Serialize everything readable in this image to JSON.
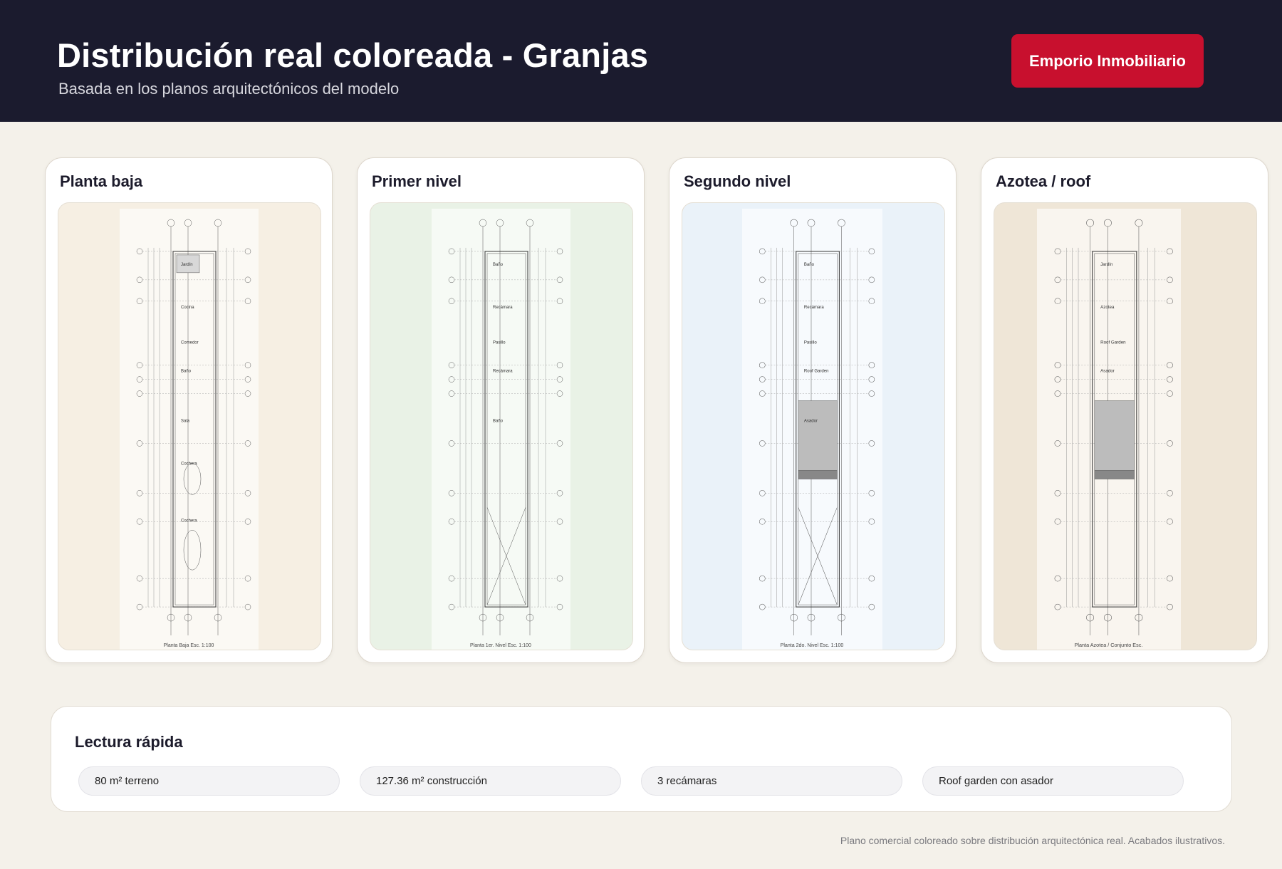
{
  "header": {
    "title": "Distribución real coloreada - Granjas",
    "subtitle": "Basada en los planos arquitectónicos del modelo",
    "brand_button": "Emporio Inmobiliario",
    "background": "#1b1b2e",
    "accent": "#c8102e"
  },
  "floors": [
    {
      "title": "Planta baja",
      "tint": "#f6efe3",
      "caption": "Planta Baja Esc. 1:100",
      "room_labels": [
        "Jardín",
        "Cocina",
        "Comedor",
        "Baño",
        "Sala",
        "Cochera",
        "Cochera"
      ]
    },
    {
      "title": "Primer nivel",
      "tint": "#e9f2e6",
      "caption": "Planta 1er. Nivel Esc. 1:100",
      "room_labels": [
        "Baño",
        "Recámara",
        "Pasillo",
        "Recámara",
        "Baño"
      ]
    },
    {
      "title": "Segundo nivel",
      "tint": "#eaf2f9",
      "caption": "Planta 2do. Nivel Esc. 1:100",
      "room_labels": [
        "Baño",
        "Recámara",
        "Pasillo",
        "Roof Garden",
        "Asador"
      ]
    },
    {
      "title": "Azotea / roof",
      "tint": "#efe6d7",
      "caption": "Planta Azotea / Conjunto Esc.",
      "room_labels": [
        "Jardín",
        "Azotea",
        "Roof Garden",
        "Asador"
      ]
    }
  ],
  "summary": {
    "title": "Lectura rápida",
    "chips": [
      "80 m² terreno",
      "127.36 m² construcción",
      "3 recámaras",
      "Roof garden con asador"
    ]
  },
  "footnote": "Plano comercial coloreado sobre distribución arquitectónica real. Acabados ilustrativos."
}
